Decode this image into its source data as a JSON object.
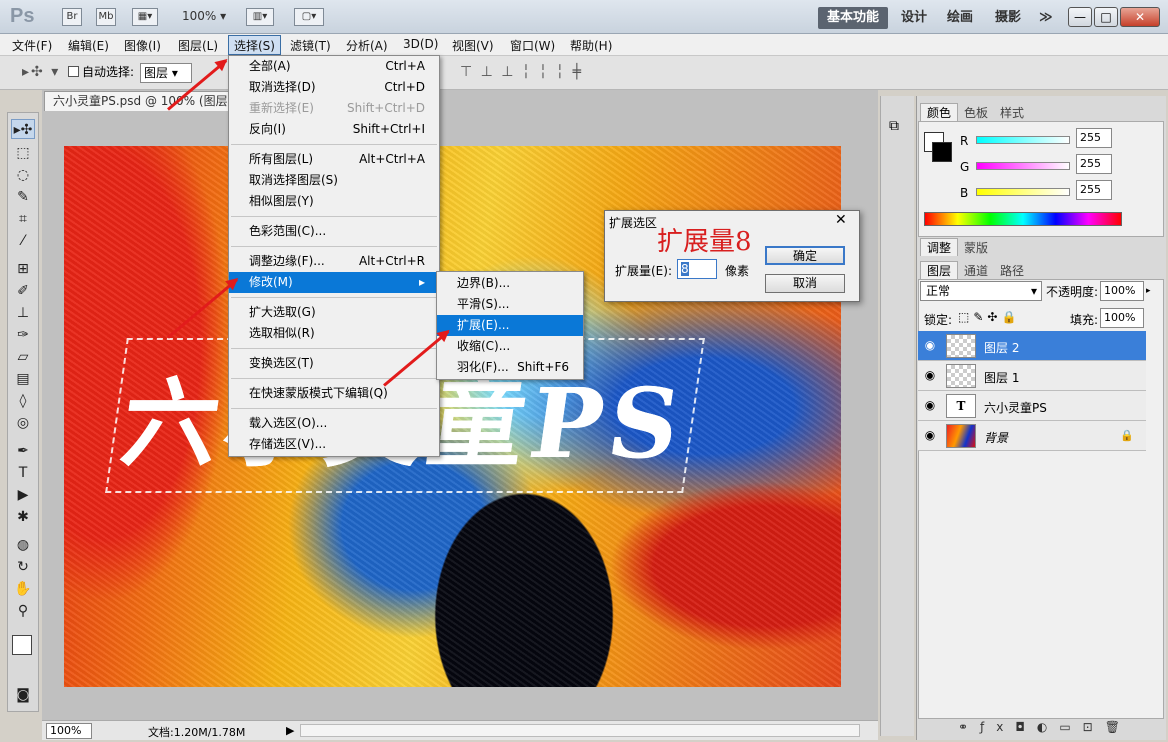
{
  "app": {
    "logo": "Ps",
    "zoom": "100%",
    "btn_br": "Br",
    "btn_mb": "Mb"
  },
  "workspaces": [
    "基本功能",
    "设计",
    "绘画",
    "摄影"
  ],
  "window_controls": {
    "more": "≫",
    "minimize": "—",
    "maximize": "□",
    "close": "✕"
  },
  "menu": [
    "文件(F)",
    "编辑(E)",
    "图像(I)",
    "图层(L)",
    "选择(S)",
    "滤镜(T)",
    "分析(A)",
    "3D(D)",
    "视图(V)",
    "窗口(W)",
    "帮助(H)"
  ],
  "options": {
    "auto_select_label": "自动选择:",
    "auto_select_value": "图层"
  },
  "document": {
    "tab_title": "六小灵童PS.psd @ 100% (图层 2",
    "canvas_text": "六小灵童PS",
    "status_zoom": "100%",
    "status_doc": "文档:1.20M/1.78M"
  },
  "select_menu": [
    {
      "label": "全部(A)",
      "shortcut": "Ctrl+A"
    },
    {
      "label": "取消选择(D)",
      "shortcut": "Ctrl+D"
    },
    {
      "label": "重新选择(E)",
      "shortcut": "Shift+Ctrl+D"
    },
    {
      "label": "反向(I)",
      "shortcut": "Shift+Ctrl+I"
    },
    {
      "label": "所有图层(L)",
      "shortcut": "Alt+Ctrl+A"
    },
    {
      "label": "取消选择图层(S)",
      "shortcut": ""
    },
    {
      "label": "相似图层(Y)",
      "shortcut": ""
    },
    {
      "label": "色彩范围(C)...",
      "shortcut": ""
    },
    {
      "label": "调整边缘(F)...",
      "shortcut": "Alt+Ctrl+R"
    },
    {
      "label": "修改(M)",
      "shortcut": ""
    },
    {
      "label": "扩大选取(G)",
      "shortcut": ""
    },
    {
      "label": "选取相似(R)",
      "shortcut": ""
    },
    {
      "label": "变换选区(T)",
      "shortcut": ""
    },
    {
      "label": "在快速蒙版模式下编辑(Q)",
      "shortcut": ""
    },
    {
      "label": "载入选区(O)...",
      "shortcut": ""
    },
    {
      "label": "存储选区(V)...",
      "shortcut": ""
    }
  ],
  "modify_menu": [
    {
      "label": "边界(B)...",
      "shortcut": ""
    },
    {
      "label": "平滑(S)...",
      "shortcut": ""
    },
    {
      "label": "扩展(E)...",
      "shortcut": ""
    },
    {
      "label": "收缩(C)...",
      "shortcut": ""
    },
    {
      "label": "羽化(F)...",
      "shortcut": "Shift+F6"
    }
  ],
  "dialog": {
    "title": "扩展选区",
    "annotation": "扩展量8",
    "field_label": "扩展量(E):",
    "field_value": "8",
    "unit": "像素",
    "ok": "确定",
    "cancel": "取消",
    "close": "✕"
  },
  "color_panel": {
    "tabs": [
      "颜色",
      "色板",
      "样式"
    ],
    "channels": [
      {
        "name": "R",
        "value": "255"
      },
      {
        "name": "G",
        "value": "255"
      },
      {
        "name": "B",
        "value": "255"
      }
    ]
  },
  "adjust_tabs": [
    "调整",
    "蒙版"
  ],
  "layers_panel": {
    "tabs": [
      "图层",
      "通道",
      "路径"
    ],
    "blend_mode": "正常",
    "opacity_label": "不透明度:",
    "opacity": "100%",
    "lock_label": "锁定:",
    "fill_label": "填充:",
    "fill": "100%",
    "layers": [
      {
        "name": "图层 2",
        "thumb": ""
      },
      {
        "name": "图层 1",
        "thumb": ""
      },
      {
        "name": "六小灵童PS",
        "thumb": "T"
      },
      {
        "name": "背景",
        "thumb": ""
      }
    ]
  },
  "colors": {
    "highlight": "#0a78d7",
    "arrow": "#e21b1b",
    "dialog_annotation": "#d81f1f"
  }
}
